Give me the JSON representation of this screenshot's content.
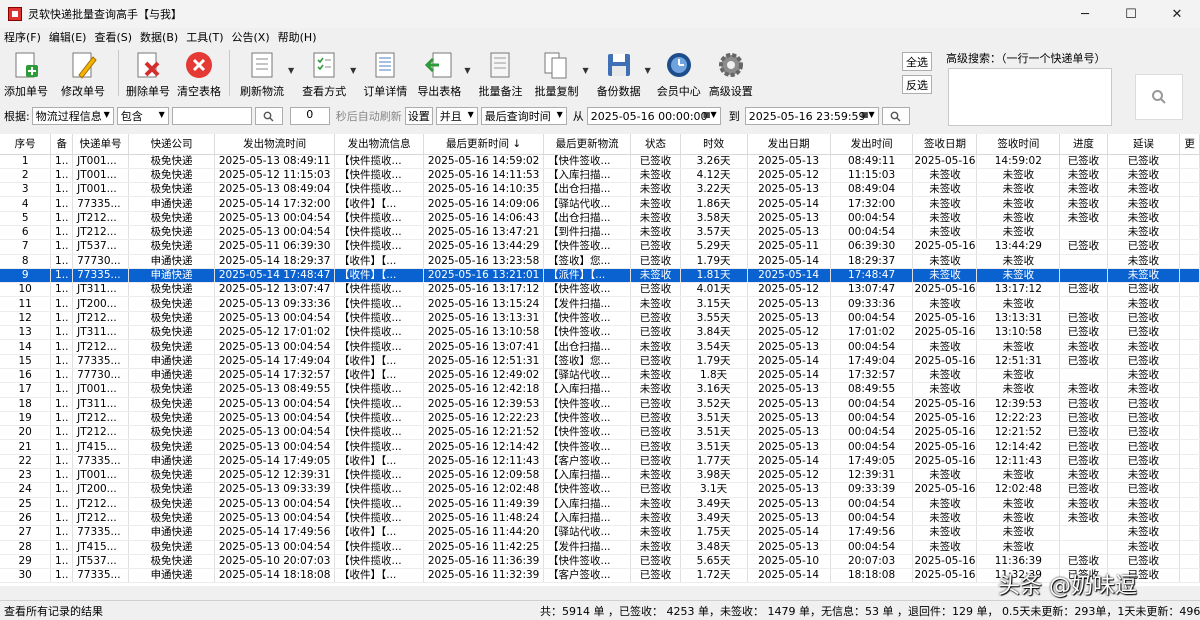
{
  "window": {
    "title": "灵软快递批量查询高手【与我】",
    "minimize": "─",
    "maximize": "☐",
    "close": "✕"
  },
  "menu": [
    "程序(F)",
    "编辑(E)",
    "查看(S)",
    "数据(B)",
    "工具(T)",
    "公告(X)",
    "帮助(H)"
  ],
  "toolbar": {
    "add": "添加单号",
    "edit": "修改单号",
    "delete": "删除单号",
    "clear": "清空表格",
    "refresh": "刷新物流",
    "view_mode": "查看方式",
    "order_detail": "订单详情",
    "export": "导出表格",
    "batch_note": "批量备注",
    "batch_copy": "批量复制",
    "backup": "备份数据",
    "member": "会员中心",
    "advanced": "高级设置",
    "select_all": "全选",
    "invert": "反选"
  },
  "adv_search": {
    "label": "高级搜索：（一行一个快递单号）",
    "value": ""
  },
  "filter": {
    "by_label": "根据:",
    "field": "物流过程信息",
    "match": "包含",
    "keyword": "",
    "seconds": "0",
    "auto_refresh_label": "秒后自动刷新",
    "settings": "设置",
    "logic": "并且",
    "time_field": "最后查询时间",
    "from_label": "从",
    "from": "2025-05-16 00:00:00",
    "to_label": "到",
    "to": "2025-05-16 23:59:59"
  },
  "columns": [
    "序号",
    "备",
    "快递单号",
    "快递公司",
    "发出物流时间",
    "发出物流信息",
    "最后更新时间 ↓",
    "最后更新物流",
    "状态",
    "时效",
    "发出日期",
    "发出时间",
    "签收日期",
    "签收时间",
    "进度",
    "延误",
    "更"
  ],
  "rows": [
    [
      "1",
      "1..",
      "JT001...",
      "极免快递",
      "2025-05-13 08:49:11",
      "【快件揽收...",
      "2025-05-16 14:59:02",
      "【快件签收...",
      "已签收",
      "3.26天",
      "2025-05-13",
      "08:49:11",
      "2025-05-16",
      "14:59:02",
      "已签收",
      "已签收",
      ""
    ],
    [
      "2",
      "1..",
      "JT001...",
      "极免快递",
      "2025-05-12 11:15:03",
      "【快件揽收...",
      "2025-05-16 14:11:53",
      "【入库扫描...",
      "未签收",
      "4.12天",
      "2025-05-12",
      "11:15:03",
      "未签收",
      "未签收",
      "未签收",
      "未签收",
      ""
    ],
    [
      "3",
      "1..",
      "JT001...",
      "极免快递",
      "2025-05-13 08:49:04",
      "【快件揽收...",
      "2025-05-16 14:10:35",
      "【出仓扫描...",
      "未签收",
      "3.22天",
      "2025-05-13",
      "08:49:04",
      "未签收",
      "未签收",
      "未签收",
      "未签收",
      ""
    ],
    [
      "4",
      "1..",
      "77335...",
      "申通快递",
      "2025-05-14 17:32:00",
      "【收件】【...",
      "2025-05-16 14:09:06",
      "【驿站代收...",
      "未签收",
      "1.86天",
      "2025-05-14",
      "17:32:00",
      "未签收",
      "未签收",
      "未签收",
      "未签收",
      ""
    ],
    [
      "5",
      "1..",
      "JT212...",
      "极免快递",
      "2025-05-13 00:04:54",
      "【快件揽收...",
      "2025-05-16 14:06:43",
      "【出仓扫描...",
      "未签收",
      "3.58天",
      "2025-05-13",
      "00:04:54",
      "未签收",
      "未签收",
      "未签收",
      "未签收",
      ""
    ],
    [
      "6",
      "1..",
      "JT212...",
      "极免快递",
      "2025-05-13 00:04:54",
      "【快件揽收...",
      "2025-05-16 13:47:21",
      "【到件扫描...",
      "未签收",
      "3.57天",
      "2025-05-13",
      "00:04:54",
      "未签收",
      "未签收",
      "",
      "未签收",
      ""
    ],
    [
      "7",
      "1..",
      "JT537...",
      "极免快递",
      "2025-05-11 06:39:30",
      "【快件揽收...",
      "2025-05-16 13:44:29",
      "【快件签收...",
      "已签收",
      "5.29天",
      "2025-05-11",
      "06:39:30",
      "2025-05-16",
      "13:44:29",
      "已签收",
      "已签收",
      ""
    ],
    [
      "8",
      "1..",
      "77730...",
      "申通快递",
      "2025-05-14 18:29:37",
      "【收件】【...",
      "2025-05-16 13:23:58",
      "【签收】您...",
      "已签收",
      "1.79天",
      "2025-05-14",
      "18:29:37",
      "未签收",
      "未签收",
      "",
      "未签收",
      ""
    ],
    [
      "9",
      "1..",
      "77335...",
      "申通快递",
      "2025-05-14 17:48:47",
      "【收件】【...",
      "2025-05-16 13:21:01",
      "【派件】【...",
      "未签收",
      "1.81天",
      "2025-05-14",
      "17:48:47",
      "未签收",
      "未签收",
      "",
      "未签收",
      ""
    ],
    [
      "10",
      "1..",
      "JT311...",
      "极免快递",
      "2025-05-12 13:07:47",
      "【快件揽收...",
      "2025-05-16 13:17:12",
      "【快件签收...",
      "已签收",
      "4.01天",
      "2025-05-12",
      "13:07:47",
      "2025-05-16",
      "13:17:12",
      "已签收",
      "已签收",
      ""
    ],
    [
      "11",
      "1..",
      "JT200...",
      "极免快递",
      "2025-05-13 09:33:36",
      "【快件揽收...",
      "2025-05-16 13:15:24",
      "【发件扫描...",
      "未签收",
      "3.15天",
      "2025-05-13",
      "09:33:36",
      "未签收",
      "未签收",
      "",
      "未签收",
      ""
    ],
    [
      "12",
      "1..",
      "JT212...",
      "极免快递",
      "2025-05-13 00:04:54",
      "【快件揽收...",
      "2025-05-16 13:13:31",
      "【快件签收...",
      "已签收",
      "3.55天",
      "2025-05-13",
      "00:04:54",
      "2025-05-16",
      "13:13:31",
      "已签收",
      "已签收",
      ""
    ],
    [
      "13",
      "1..",
      "JT311...",
      "极免快递",
      "2025-05-12 17:01:02",
      "【快件揽收...",
      "2025-05-16 13:10:58",
      "【快件签收...",
      "已签收",
      "3.84天",
      "2025-05-12",
      "17:01:02",
      "2025-05-16",
      "13:10:58",
      "已签收",
      "已签收",
      ""
    ],
    [
      "14",
      "1..",
      "JT212...",
      "极免快递",
      "2025-05-13 00:04:54",
      "【快件揽收...",
      "2025-05-16 13:07:41",
      "【出仓扫描...",
      "未签收",
      "3.54天",
      "2025-05-13",
      "00:04:54",
      "未签收",
      "未签收",
      "未签收",
      "未签收",
      ""
    ],
    [
      "15",
      "1..",
      "77335...",
      "申通快递",
      "2025-05-14 17:49:04",
      "【收件】【...",
      "2025-05-16 12:51:31",
      "【签收】您...",
      "已签收",
      "1.79天",
      "2025-05-14",
      "17:49:04",
      "2025-05-16",
      "12:51:31",
      "已签收",
      "已签收",
      ""
    ],
    [
      "16",
      "1..",
      "77730...",
      "申通快递",
      "2025-05-14 17:32:57",
      "【收件】【...",
      "2025-05-16 12:49:02",
      "【驿站代收...",
      "未签收",
      "1.8天",
      "2025-05-14",
      "17:32:57",
      "未签收",
      "未签收",
      "",
      "未签收",
      ""
    ],
    [
      "17",
      "1..",
      "JT001...",
      "极免快递",
      "2025-05-13 08:49:55",
      "【快件揽收...",
      "2025-05-16 12:42:18",
      "【入库扫描...",
      "未签收",
      "3.16天",
      "2025-05-13",
      "08:49:55",
      "未签收",
      "未签收",
      "未签收",
      "未签收",
      ""
    ],
    [
      "18",
      "1..",
      "JT311...",
      "极免快递",
      "2025-05-13 00:04:54",
      "【快件揽收...",
      "2025-05-16 12:39:53",
      "【快件签收...",
      "已签收",
      "3.52天",
      "2025-05-13",
      "00:04:54",
      "2025-05-16",
      "12:39:53",
      "已签收",
      "已签收",
      ""
    ],
    [
      "19",
      "1..",
      "JT212...",
      "极免快递",
      "2025-05-13 00:04:54",
      "【快件揽收...",
      "2025-05-16 12:22:23",
      "【快件签收...",
      "已签收",
      "3.51天",
      "2025-05-13",
      "00:04:54",
      "2025-05-16",
      "12:22:23",
      "已签收",
      "已签收",
      ""
    ],
    [
      "20",
      "1..",
      "JT212...",
      "极免快递",
      "2025-05-13 00:04:54",
      "【快件揽收...",
      "2025-05-16 12:21:52",
      "【快件签收...",
      "已签收",
      "3.51天",
      "2025-05-13",
      "00:04:54",
      "2025-05-16",
      "12:21:52",
      "已签收",
      "已签收",
      ""
    ],
    [
      "21",
      "1..",
      "JT415...",
      "极免快递",
      "2025-05-13 00:04:54",
      "【快件揽收...",
      "2025-05-16 12:14:42",
      "【快件签收...",
      "已签收",
      "3.51天",
      "2025-05-13",
      "00:04:54",
      "2025-05-16",
      "12:14:42",
      "已签收",
      "已签收",
      ""
    ],
    [
      "22",
      "1..",
      "77335...",
      "申通快递",
      "2025-05-14 17:49:05",
      "【收件】【...",
      "2025-05-16 12:11:43",
      "【客户签收...",
      "已签收",
      "1.77天",
      "2025-05-14",
      "17:49:05",
      "2025-05-16",
      "12:11:43",
      "已签收",
      "已签收",
      ""
    ],
    [
      "23",
      "1..",
      "JT001...",
      "极免快递",
      "2025-05-12 12:39:31",
      "【快件揽收...",
      "2025-05-16 12:09:58",
      "【入库扫描...",
      "未签收",
      "3.98天",
      "2025-05-12",
      "12:39:31",
      "未签收",
      "未签收",
      "未签收",
      "未签收",
      ""
    ],
    [
      "24",
      "1..",
      "JT200...",
      "极免快递",
      "2025-05-13 09:33:39",
      "【快件揽收...",
      "2025-05-16 12:02:48",
      "【快件签收...",
      "已签收",
      "3.1天",
      "2025-05-13",
      "09:33:39",
      "2025-05-16",
      "12:02:48",
      "已签收",
      "已签收",
      ""
    ],
    [
      "25",
      "1..",
      "JT212...",
      "极免快递",
      "2025-05-13 00:04:54",
      "【快件揽收...",
      "2025-05-16 11:49:39",
      "【入库扫描...",
      "未签收",
      "3.49天",
      "2025-05-13",
      "00:04:54",
      "未签收",
      "未签收",
      "未签收",
      "未签收",
      ""
    ],
    [
      "26",
      "1..",
      "JT212...",
      "极免快递",
      "2025-05-13 00:04:54",
      "【快件揽收...",
      "2025-05-16 11:48:24",
      "【入库扫描...",
      "未签收",
      "3.49天",
      "2025-05-13",
      "00:04:54",
      "未签收",
      "未签收",
      "未签收",
      "未签收",
      ""
    ],
    [
      "27",
      "1..",
      "77335...",
      "申通快递",
      "2025-05-14 17:49:56",
      "【收件】【...",
      "2025-05-16 11:44:20",
      "【驿站代收...",
      "未签收",
      "1.75天",
      "2025-05-14",
      "17:49:56",
      "未签收",
      "未签收",
      "",
      "未签收",
      ""
    ],
    [
      "28",
      "1..",
      "JT415...",
      "极免快递",
      "2025-05-13 00:04:54",
      "【快件揽收...",
      "2025-05-16 11:42:25",
      "【发件扫描...",
      "未签收",
      "3.48天",
      "2025-05-13",
      "00:04:54",
      "未签收",
      "未签收",
      "",
      "未签收",
      ""
    ],
    [
      "29",
      "1..",
      "JT537...",
      "极免快递",
      "2025-05-10 20:07:03",
      "【快件揽收...",
      "2025-05-16 11:36:39",
      "【快件签收...",
      "已签收",
      "5.65天",
      "2025-05-10",
      "20:07:03",
      "2025-05-16",
      "11:36:39",
      "已签收",
      "已签收",
      ""
    ],
    [
      "30",
      "1..",
      "77335...",
      "申通快递",
      "2025-05-14 18:18:08",
      "【收件】【...",
      "2025-05-16 11:32:39",
      "【客户签收...",
      "已签收",
      "1.72天",
      "2025-05-14",
      "18:18:08",
      "2025-05-16",
      "11:32:39",
      "已签收",
      "已签收",
      ""
    ]
  ],
  "selected_row": 9,
  "status": {
    "left": "查看所有记录的结果",
    "right": "共：5914 单 ，已签收： 4253 单，未签收： 1479 单，无信息：53 单 ，退回件：129 单， 0.5天未更新：293单，1天未更新：496 单，"
  },
  "watermark": "头条 @奶味逗",
  "colors": {
    "selection": "#0a62d0",
    "close_red": "#e53935"
  }
}
